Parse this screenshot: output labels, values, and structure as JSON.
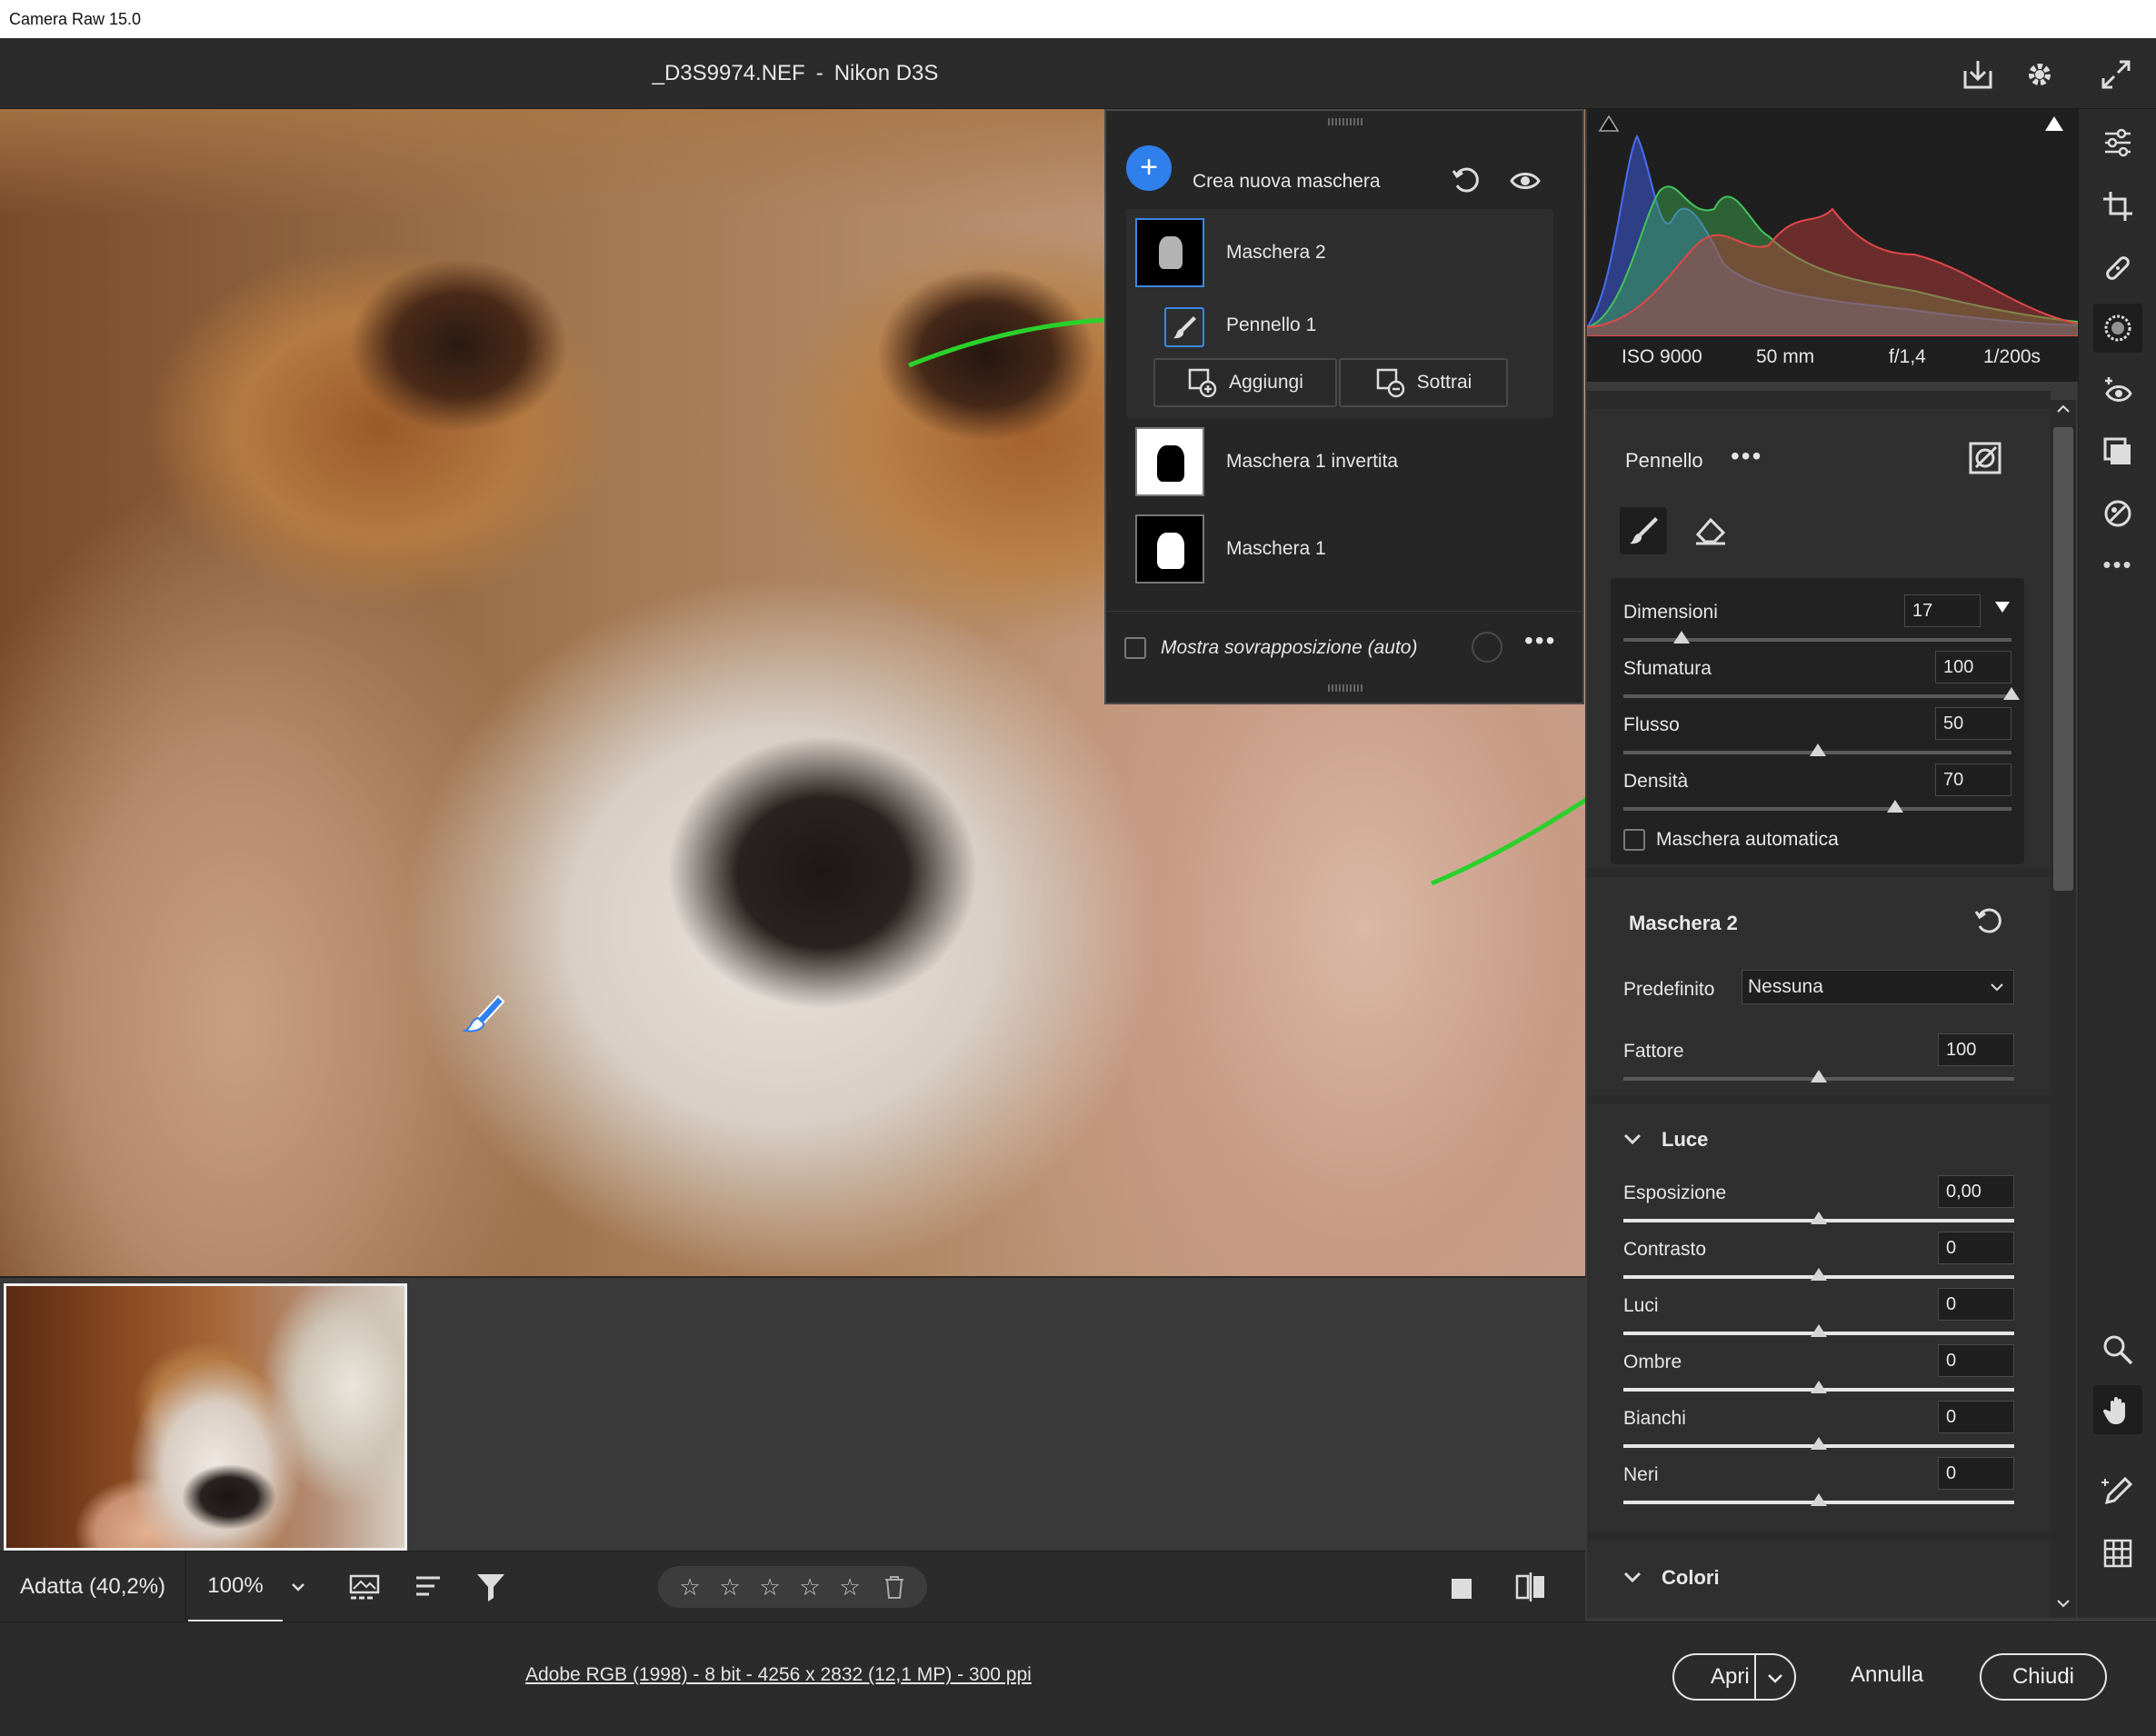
{
  "window": {
    "os_title": "Camera Raw 15.0"
  },
  "document": {
    "filename": "_D3S9974.NEF",
    "separator": "-",
    "camera": "Nikon D3S"
  },
  "mask_panel": {
    "create_label": "Crea nuova maschera",
    "items": [
      {
        "label": "Maschera 2"
      },
      {
        "label": "Pennello 1"
      },
      {
        "label": "Maschera 1 invertita"
      },
      {
        "label": "Maschera 1"
      }
    ],
    "add_label": "Aggiungi",
    "subtract_label": "Sottrai",
    "overlay_label": "Mostra sovrapposizione (auto)"
  },
  "exif": {
    "iso": "ISO 9000",
    "focal": "50 mm",
    "aperture": "f/1,4",
    "shutter": "1/200s"
  },
  "brush": {
    "title": "Pennello",
    "sliders": [
      {
        "label": "Dimensioni",
        "value": "17",
        "level": 0.15
      },
      {
        "label": "Sfumatura",
        "value": "100",
        "level": 1.0
      },
      {
        "label": "Flusso",
        "value": "50",
        "level": 0.5
      },
      {
        "label": "Densità",
        "value": "70",
        "level": 0.7
      }
    ],
    "auto_mask_label": "Maschera automatica"
  },
  "mask2": {
    "title": "Maschera 2",
    "preset_label": "Predefinito",
    "preset_value": "Nessuna",
    "amount_label": "Fattore",
    "amount_value": "100",
    "amount_level": 0.5
  },
  "light": {
    "title": "Luce",
    "sliders": [
      {
        "label": "Esposizione",
        "value": "0,00",
        "level": 0.5
      },
      {
        "label": "Contrasto",
        "value": "0",
        "level": 0.5
      },
      {
        "label": "Luci",
        "value": "0",
        "level": 0.5
      },
      {
        "label": "Ombre",
        "value": "0",
        "level": 0.5
      },
      {
        "label": "Bianchi",
        "value": "0",
        "level": 0.5
      },
      {
        "label": "Neri",
        "value": "0",
        "level": 0.5
      }
    ]
  },
  "colors": {
    "title": "Colori"
  },
  "zoom": {
    "fit_label": "Adatta (40,2%)",
    "level_label": "100%"
  },
  "rating": {
    "stars": [
      "☆",
      "☆",
      "☆",
      "☆",
      "☆"
    ]
  },
  "status": {
    "image_info": "Adobe RGB (1998) - 8 bit - 4256 x 2832 (12,1 MP) - 300 ppi",
    "open_label": "Apri",
    "cancel_label": "Annulla",
    "close_label": "Chiudi"
  },
  "colors_theme": {
    "accent": "#2f80ed",
    "annotation": "#2bd12b",
    "panel": "#2b2b2b"
  }
}
